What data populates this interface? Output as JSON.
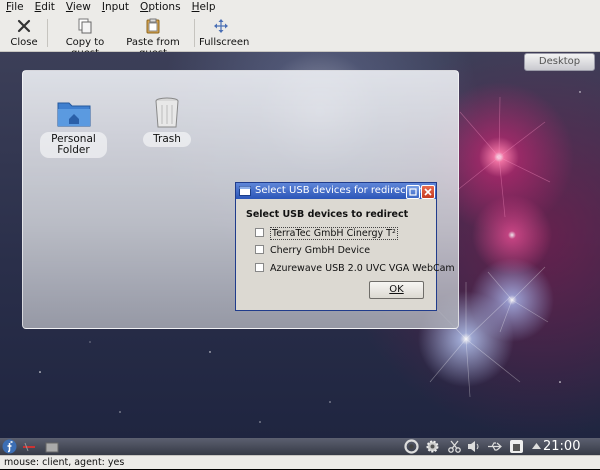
{
  "menubar": {
    "items": [
      "File",
      "Edit",
      "View",
      "Input",
      "Options",
      "Help"
    ]
  },
  "toolbar": {
    "close_label": "Close",
    "copy_label": "Copy to guest",
    "paste_label": "Paste from guest",
    "fullscreen_label": "Fullscreen"
  },
  "desktop": {
    "desktop_button": "Desktop",
    "icons": [
      {
        "label_line1": "Personal",
        "label_line2": "Folder",
        "icon": "folder-icon"
      },
      {
        "label": "Trash",
        "icon": "trash-icon"
      }
    ]
  },
  "dialog": {
    "title": "Select USB devices for redirection",
    "heading": "Select USB devices to redirect",
    "devices": [
      {
        "label": "TerraTec GmbH Cinergy T²",
        "checked": false
      },
      {
        "label": "Cherry GmbH Device",
        "checked": false
      },
      {
        "label": "Azurewave USB 2.0 UVC VGA WebCam",
        "checked": false
      }
    ],
    "ok_label": "OK"
  },
  "taskbar": {
    "clock": "21:00"
  },
  "statusbar": {
    "text": "mouse: client, agent: yes"
  },
  "colors": {
    "title_bar": "#2b55b8",
    "desktop_bg": "#2a2f4a",
    "accent_pink": "#e0308a"
  }
}
